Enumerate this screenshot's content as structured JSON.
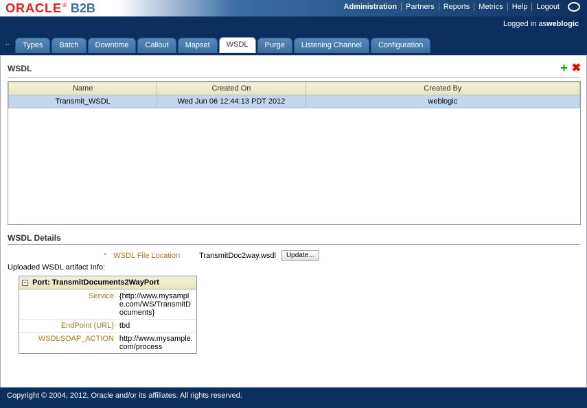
{
  "logo": {
    "brand": "ORACLE",
    "product": "B2B"
  },
  "nav": {
    "administration": "Administration",
    "partners": "Partners",
    "reports": "Reports",
    "metrics": "Metrics",
    "help": "Help",
    "logout": "Logout"
  },
  "userbar": {
    "prefix": "Logged in as ",
    "user": "weblogic"
  },
  "tabs": {
    "types": "Types",
    "batch": "Batch",
    "downtime": "Downtime",
    "callout": "Callout",
    "mapset": "Mapset",
    "wsdl": "WSDL",
    "purge": "Purge",
    "listening": "Listening Channel",
    "configuration": "Configuration"
  },
  "panel": {
    "title": "WSDL"
  },
  "icons": {
    "add": "+",
    "remove": "✖"
  },
  "table": {
    "cols": {
      "name": "Name",
      "created_on": "Created On",
      "created_by": "Created By"
    },
    "rows": [
      {
        "name": "Transmit_WSDL",
        "created_on": "Wed Jun 06 12:44:13 PDT 2012",
        "created_by": "weblogic"
      }
    ]
  },
  "details": {
    "title": "WSDL Details",
    "location_label": "WSDL File Location",
    "location_value": "TransmitDoc2way.wsdl",
    "update_btn": "Update...",
    "artifact_label": "Uploaded WSDL artifact Info:",
    "port_prefix": "Port: ",
    "port": "TransmitDocuments2WayPort",
    "service_k": "Service",
    "service_v": "{http://www.mysample.com/WS/TransmitDocuments}",
    "endpoint_k": "EndPoint (URL)",
    "endpoint_v": "tbd",
    "soap_k": "WSDLSOAP_ACTION",
    "soap_v": "http://www.mysample.com/process"
  },
  "footer": "Copyright © 2004, 2012, Oracle and/or its affiliates. All rights reserved."
}
